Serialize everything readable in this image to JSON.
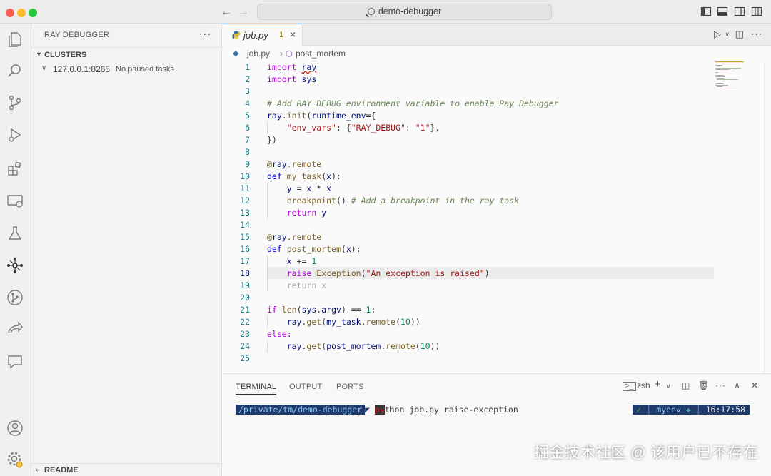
{
  "titlebar": {
    "search_label": "demo-debugger"
  },
  "sidebar": {
    "title": "RAY DEBUGGER",
    "more": "···",
    "clusters_label": "CLUSTERS",
    "cluster": {
      "address": "127.0.0.1:8265",
      "status": "No paused tasks"
    },
    "readme_label": "README"
  },
  "editor": {
    "tab": {
      "filename": "job.py",
      "problems": "1",
      "close": "×"
    },
    "breadcrumb": {
      "file": "job.py",
      "symbol": "post_mortem"
    },
    "line_numbers": [
      "1",
      "2",
      "3",
      "4",
      "5",
      "6",
      "7",
      "8",
      "9",
      "10",
      "11",
      "12",
      "13",
      "14",
      "15",
      "16",
      "17",
      "18",
      "19",
      "20",
      "21",
      "22",
      "23",
      "24",
      "25"
    ],
    "code": {
      "l1_kw": "import",
      "l1_mod": "ray",
      "l2_kw": "import",
      "l2_mod": "sys",
      "l4": "# Add RAY_DEBUG environment variable to enable Ray Debugger",
      "l5_a": "ray",
      "l5_b": ".",
      "l5_c": "init",
      "l5_d": "(",
      "l5_e": "runtime_env",
      "l5_f": "={",
      "l6_a": "\"env_vars\"",
      "l6_b": ": {",
      "l6_c": "\"RAY_DEBUG\"",
      "l6_d": ": ",
      "l6_e": "\"1\"",
      "l6_f": "},",
      "l7": "})",
      "l9_a": "@",
      "l9_b": "ray",
      "l9_c": ".remote",
      "l10_a": "def",
      "l10_b": "my_task",
      "l10_c": "(",
      "l10_d": "x",
      "l10_e": "):",
      "l11_a": "y",
      "l11_b": " = ",
      "l11_c": "x",
      "l11_d": " * ",
      "l11_e": "x",
      "l12_a": "breakpoint",
      "l12_b": "() ",
      "l12_c": "# Add a breakpoint in the ray task",
      "l13_a": "return",
      "l13_b": "y",
      "l15_a": "@",
      "l15_b": "ray",
      "l15_c": ".remote",
      "l16_a": "def",
      "l16_b": "post_mortem",
      "l16_c": "(",
      "l16_d": "x",
      "l16_e": "):",
      "l17_a": "x",
      "l17_b": " += ",
      "l17_c": "1",
      "l18_a": "raise",
      "l18_b": "Exception",
      "l18_c": "(",
      "l18_d": "\"An exception is raised\"",
      "l18_e": ")",
      "l19": "return x",
      "l21_a": "if",
      "l21_b": "len",
      "l21_c": "(",
      "l21_d": "sys",
      "l21_e": ".",
      "l21_f": "argv",
      "l21_g": ") == ",
      "l21_h": "1",
      "l21_i": ":",
      "l22_a": "ray",
      "l22_b": ".",
      "l22_c": "get",
      "l22_d": "(",
      "l22_e": "my_task",
      "l22_f": ".",
      "l22_g": "remote",
      "l22_h": "(",
      "l22_i": "10",
      "l22_j": "))",
      "l23": "else:",
      "l24_a": "ray",
      "l24_b": ".",
      "l24_c": "get",
      "l24_d": "(",
      "l24_e": "post_mortem",
      "l24_f": ".",
      "l24_g": "remote",
      "l24_h": "(",
      "l24_i": "10",
      "l24_j": "))"
    }
  },
  "panel": {
    "tabs": [
      "TERMINAL",
      "OUTPUT",
      "PORTS"
    ],
    "shell": "zsh",
    "prompt_path": "/private/tm/demo-debugger",
    "cmd_py": "py",
    "cmd_rest": "thon job.py raise-exception",
    "check": "✓",
    "env": "myenv",
    "time": "16:17:58"
  },
  "watermark": "掘金技术社区 @ 该用户已不存在",
  "colors": {
    "accent": "#0066b8",
    "prompt_bg": "#1f3a6b",
    "watermark": "#ffffff"
  }
}
